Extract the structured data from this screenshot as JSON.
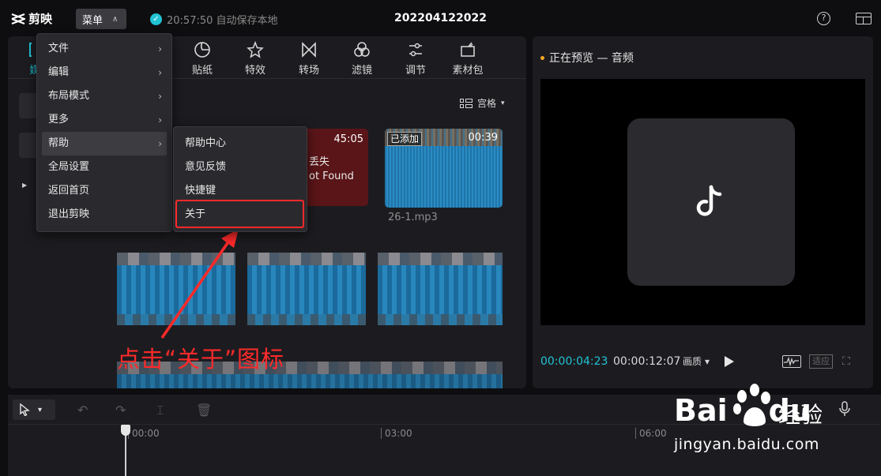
{
  "app": {
    "logo_text": "剪映",
    "menu_label": "菜单",
    "save_status": "20:57:50 自动保存本地",
    "project_title": "202204122022"
  },
  "toolbar": {
    "items": [
      {
        "label": "媒",
        "icon": "media-icon"
      },
      {
        "label": "贴纸",
        "icon": "sticker-icon"
      },
      {
        "label": "特效",
        "icon": "effects-star-icon"
      },
      {
        "label": "转场",
        "icon": "transition-bowtie-icon"
      },
      {
        "label": "滤镜",
        "icon": "filter-circles-icon"
      },
      {
        "label": "调节",
        "icon": "adjust-sliders-icon"
      },
      {
        "label": "素材包",
        "icon": "material-pack-icon"
      }
    ],
    "sort_label": "宫格"
  },
  "media": {
    "lost_card": {
      "duration": "45:05",
      "line1": "丢失",
      "line2": "ot Found"
    },
    "audio_card": {
      "added_badge": "已添加",
      "duration": "00:39",
      "filename": "26-1.mp3"
    }
  },
  "annotation": "点击“关于”图标",
  "context_menu": {
    "items": [
      {
        "label": "文件",
        "arrow": "›"
      },
      {
        "label": "编辑",
        "arrow": "›"
      },
      {
        "label": "布局模式",
        "arrow": "›"
      },
      {
        "label": "更多",
        "arrow": "›"
      },
      {
        "label": "帮助",
        "arrow": "›"
      },
      {
        "label": "全局设置",
        "arrow": ""
      },
      {
        "label": "返回首页",
        "arrow": ""
      },
      {
        "label": "退出剪映",
        "arrow": ""
      }
    ],
    "hover_index": 4
  },
  "submenu": {
    "items": [
      "帮助中心",
      "意见反馈",
      "快捷键",
      "关于"
    ]
  },
  "preview": {
    "header": "正在预览 — 音频",
    "time_current": "00:00:04:23",
    "time_total": "00:00:12:07",
    "quality_label": "画质",
    "adapt_label": "适应"
  },
  "timeline": {
    "ticks": [
      "00:00",
      "03:00",
      "06:00"
    ]
  },
  "watermark": {
    "brand": "Bai",
    "brand_suffix": "du",
    "cn": "经验",
    "url": "jingyan.baidu.com"
  },
  "colors": {
    "accent": "#21c3d5",
    "annotation_red": "#ff2a2a",
    "preview_dot": "#f5a623"
  }
}
